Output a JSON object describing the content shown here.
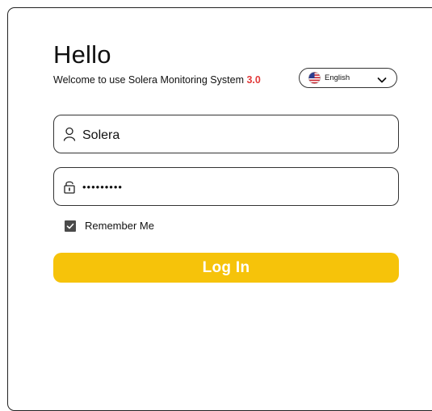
{
  "header": {
    "greeting": "Hello",
    "subtitle": "Welcome to use Solera Monitoring System",
    "version": "3.0"
  },
  "language": {
    "selected": "English",
    "flag_icon": "us-flag-icon",
    "chevron_icon": "chevron-down-icon"
  },
  "form": {
    "username": {
      "icon": "user-icon",
      "value": "Solera"
    },
    "password": {
      "icon": "lock-icon",
      "value": "•••••••••"
    },
    "remember": {
      "label": "Remember Me",
      "checked": true
    },
    "login_label": "Log In"
  },
  "colors": {
    "accent": "#f6c30a",
    "version": "#e23b3b",
    "checkbox": "#4a4a4a"
  }
}
